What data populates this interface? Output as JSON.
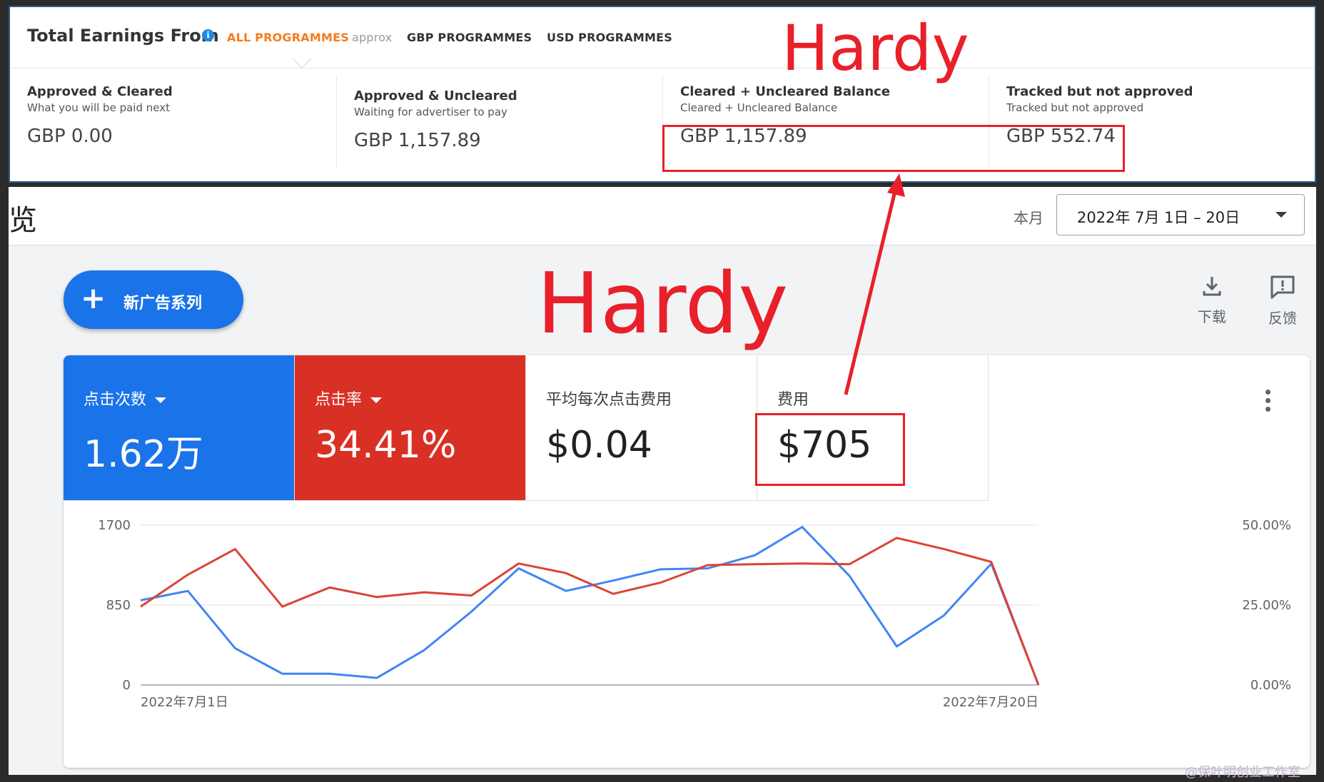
{
  "earnings": {
    "title": "Total Earnings From",
    "tabs": [
      {
        "label": "ALL PROGRAMMES",
        "suffix": "approx",
        "active": true
      },
      {
        "label": "GBP PROGRAMMES",
        "active": false
      },
      {
        "label": "USD PROGRAMMES",
        "active": false
      }
    ],
    "columns": [
      {
        "title": "Approved & Cleared",
        "subtitle": "What you will be paid next",
        "value": "GBP 0.00"
      },
      {
        "title": "Approved & Uncleared",
        "subtitle": "Waiting for advertiser to pay",
        "value": "GBP 1,157.89"
      },
      {
        "title": "Cleared + Uncleared Balance",
        "subtitle": "Cleared + Uncleared Balance",
        "value": "GBP 1,157.89"
      },
      {
        "title": "Tracked but not approved",
        "subtitle": "Tracked but not approved",
        "value": "GBP 552.74"
      }
    ]
  },
  "ads": {
    "page_title": "览",
    "range_label": "本月",
    "date_range": "2022年 7月 1日 – 20日",
    "new_campaign_label": "新广告系列",
    "tools": [
      {
        "label": "下载",
        "icon": "download-icon"
      },
      {
        "label": "反馈",
        "icon": "feedback-icon"
      }
    ],
    "metrics": [
      {
        "name": "点击次数",
        "value": "1.62万",
        "color": "#1a73e8",
        "selected": true
      },
      {
        "name": "点击率",
        "value": "34.41%",
        "color": "#d93025",
        "selected": true
      },
      {
        "name": "平均每次点击费用",
        "value": "$0.04",
        "selected": false
      },
      {
        "name": "费用",
        "value": "$705",
        "selected": false
      }
    ]
  },
  "chart_data": {
    "type": "line",
    "x": [
      "2022-07-01",
      "2022-07-02",
      "2022-07-03",
      "2022-07-04",
      "2022-07-05",
      "2022-07-06",
      "2022-07-07",
      "2022-07-08",
      "2022-07-09",
      "2022-07-10",
      "2022-07-11",
      "2022-07-12",
      "2022-07-13",
      "2022-07-14",
      "2022-07-15",
      "2022-07-16",
      "2022-07-17",
      "2022-07-18",
      "2022-07-19",
      "2022-07-20"
    ],
    "x_tick_labels": [
      "2022年7月1日",
      "2022年7月20日"
    ],
    "y_left": {
      "range": [
        0,
        1700
      ],
      "ticks": [
        "0",
        "850",
        "1700"
      ]
    },
    "y_right": {
      "range": [
        0,
        50
      ],
      "ticks": [
        "0.00%",
        "25.00%",
        "50.00%"
      ]
    },
    "series": [
      {
        "name": "点击次数",
        "axis": "left",
        "color": "#4285f4",
        "values": [
          900,
          1000,
          390,
          120,
          120,
          75,
          370,
          780,
          1240,
          1000,
          1110,
          1230,
          1240,
          1380,
          1680,
          1160,
          410,
          740,
          1290,
          0
        ]
      },
      {
        "name": "点击率",
        "axis": "right",
        "color": "#db4437",
        "values": [
          24.5,
          34.5,
          42.5,
          24.5,
          30.5,
          27.5,
          29,
          28,
          38,
          35,
          28.5,
          32,
          37.5,
          37.8,
          38,
          37.8,
          46,
          42.5,
          38.5,
          0
        ]
      }
    ]
  },
  "annotations": {
    "label_top": "Hardy",
    "label_mid": "Hardy",
    "watermark": "@保叶明创业工作室"
  }
}
